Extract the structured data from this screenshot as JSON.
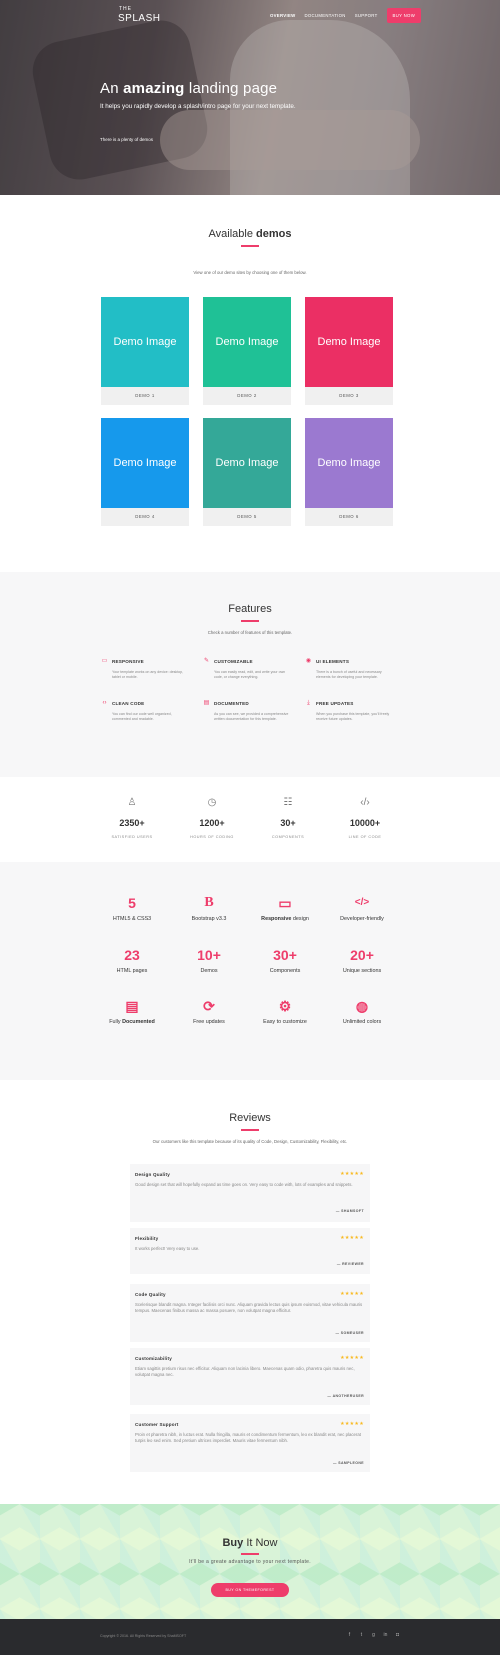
{
  "header": {
    "logo_small": "THE",
    "logo_big": "SPLASH",
    "nav": [
      "OVERVIEW",
      "DOCUMENTATION",
      "SUPPORT"
    ],
    "buy_label": "BUY NOW"
  },
  "hero": {
    "title_prefix": "An ",
    "title_bold": "amazing",
    "title_suffix": " landing page",
    "lead": "It helps you rapidly develop a splash/intro page for your next template.",
    "plenty": "There is a plenty of demos"
  },
  "demos": {
    "title_prefix": "Available ",
    "title_bold": "demos",
    "subtitle": "View one of our demo sites by choosing one of them below.",
    "image_text": "Demo Image",
    "items": [
      {
        "label": "DEMO 1",
        "color": "#22bec6"
      },
      {
        "label": "DEMO 2",
        "color": "#1fc196"
      },
      {
        "label": "DEMO 3",
        "color": "#eb2f64"
      },
      {
        "label": "DEMO 4",
        "color": "#1699ec"
      },
      {
        "label": "DEMO 5",
        "color": "#34a898"
      },
      {
        "label": "DEMO 6",
        "color": "#9b79d0"
      }
    ]
  },
  "features": {
    "title": "Features",
    "subtitle": "Check a number of features of this template.",
    "items": [
      {
        "icon": "monitor-icon",
        "title": "RESPONSIVE",
        "desc": "Your template works on any device: desktop, tablet or mobile."
      },
      {
        "icon": "wrench-icon",
        "title": "CUSTOMIZABLE",
        "desc": "You can easily read, edit, and write your own code, or change everything."
      },
      {
        "icon": "palette-icon",
        "title": "UI ELEMENTS",
        "desc": "There is a bunch of useful and necessary elements for developing your template."
      },
      {
        "icon": "code-icon",
        "title": "CLEAN CODE",
        "desc": "You can find our code well organized, commented and readable."
      },
      {
        "icon": "document-icon",
        "title": "DOCUMENTED",
        "desc": "As you can see, we provided a comprehensive written documentation for this template."
      },
      {
        "icon": "download-icon",
        "title": "FREE UPDATES",
        "desc": "When you purchase this template, you'll freely receive future updates."
      }
    ]
  },
  "counters": [
    {
      "icon": "user-icon",
      "number": "2350+",
      "label": "SATISFIED USERS"
    },
    {
      "icon": "clock-icon",
      "number": "1200+",
      "label": "HOURS OF CODING"
    },
    {
      "icon": "sliders-icon",
      "number": "30+",
      "label": "COMPONENTS"
    },
    {
      "icon": "code-icon",
      "number": "10000+",
      "label": "LINE OF CODE"
    }
  ],
  "stats": {
    "row1": [
      {
        "icon": "html5-icon",
        "glyph": "5",
        "label": "HTML5 & CSS3"
      },
      {
        "icon": "bootstrap-icon",
        "glyph": "B",
        "label": "Bootstrap v3.3"
      },
      {
        "icon": "monitor-icon",
        "glyph": "▭",
        "label_bold": "Responsive",
        "label_rest": " design"
      },
      {
        "icon": "code-icon",
        "glyph": "</>",
        "label": "Developer-friendly"
      }
    ],
    "row2": [
      {
        "number": "23",
        "label": "HTML pages"
      },
      {
        "number": "10+",
        "label": "Demos"
      },
      {
        "number": "30+",
        "label": "Components"
      },
      {
        "number": "20+",
        "label": "Unique sections"
      }
    ],
    "row3": [
      {
        "icon": "document-icon",
        "glyph": "▤",
        "label_rest": "Fully ",
        "label_bold": "Documented"
      },
      {
        "icon": "refresh-icon",
        "glyph": "⟳",
        "label": "Free updates"
      },
      {
        "icon": "gears-icon",
        "glyph": "⚙",
        "label": "Easy to customize"
      },
      {
        "icon": "palette-icon",
        "glyph": "◍",
        "label": "Unlimited colors"
      }
    ]
  },
  "reviews": {
    "title": "Reviews",
    "subtitle": "Our customers like this template because of its quality of Code, Design, Customizability, Flexibility, etc.",
    "stars": "★★★★★",
    "items": [
      {
        "title": "Design Quality",
        "text": "Good design set that will hopefully expand as time goes on. Very easy to code with, lots of examples and snippets.",
        "author": "— SHAMSOFT"
      },
      {
        "title": "Flexibility",
        "text": "It works perfect! Very easy to use.",
        "author": "— REVIEWER"
      },
      {
        "title": "Code Quality",
        "text": "Scelerisque blandit magna. Integer facilisis orci nunc. Aliquam gravida lectus quis ipsum euismod, vitae vehicula mauris tempus. Maecenas finibus massa ac massa posuere, non volutpat magna efficitur.",
        "author": "— SOMEUSER"
      },
      {
        "title": "Customizability",
        "text": "Etiam sagittis pretium risus nec efficitur. Aliquam non lacinia libero. Maecenas quam odio, pharetra quis mauris nec, volutpat magna nec.",
        "author": "— ANOTHERUSER"
      },
      {
        "title": "Customer Support",
        "text": "Proin et pharetra nibh, in luctus erat. Nulla fringilla, mauris et condimentum fermentum, leo ex blandit erat, nec placerat turpis leo sed enim. Sed pretium ultrices imperdiet. Mauris vitae fermentum nibh.",
        "author": "— SAMPLEONE"
      }
    ]
  },
  "buy": {
    "title_bold": "Buy",
    "title_rest": " It Now",
    "subtitle": "It'll be a greate advantage to your next template.",
    "cta": "BUY ON THEMEFOREST"
  },
  "footer": {
    "copyright": "Copyright © 2016. All Rights Reserved by ShaMSOFT",
    "social": [
      {
        "icon": "facebook-icon",
        "glyph": "f"
      },
      {
        "icon": "twitter-icon",
        "glyph": "t"
      },
      {
        "icon": "google-plus-icon",
        "glyph": "g"
      },
      {
        "icon": "linkedin-icon",
        "glyph": "in"
      },
      {
        "icon": "instagram-icon",
        "glyph": "◘"
      }
    ]
  }
}
